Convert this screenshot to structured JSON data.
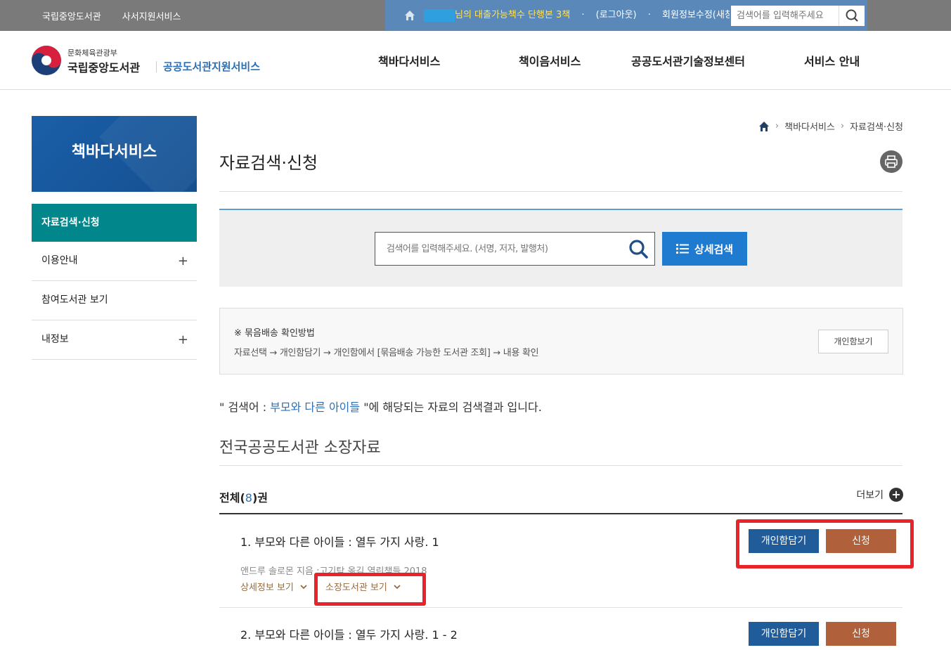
{
  "topbar": {
    "links": [
      "국립중앙도서관",
      "사서지원서비스"
    ],
    "loan_text": "님의 대출가능책수 단행본 3책",
    "logout": "(로그아웃)",
    "member_edit": "회원정보수정(새창)",
    "search_placeholder": "검색어를 입력해주세요"
  },
  "logo": {
    "ministry": "문화체육관광부",
    "library": "국립중앙도서관",
    "service": "공공도서관지원서비스"
  },
  "gnb": [
    "책바다서비스",
    "책이음서비스",
    "공공도서관기술정보센터",
    "서비스 안내"
  ],
  "sidebar": {
    "title": "책바다서비스",
    "items": [
      {
        "label": "자료검색·신청"
      },
      {
        "label": "이용안내",
        "expand": "+"
      },
      {
        "label": "참여도서관 보기"
      },
      {
        "label": "내정보",
        "expand": "+"
      }
    ]
  },
  "breadcrumb": [
    "책바다서비스",
    "자료검색·신청"
  ],
  "page_title": "자료검색·신청",
  "search": {
    "placeholder": "검색어를 입력해주세요. (서명, 저자, 발행처)",
    "detail_label": "상세검색"
  },
  "notice": {
    "heading": "※ 묶음배송 확인방법",
    "steps": "자료선택 → 개인함담기 → 개인함에서 [묶음배송 가능한 도서관 조회] → 내용 확인",
    "cart_view_label": "개인함보기"
  },
  "result": {
    "prefix": "\" 검색어 : ",
    "keyword": "부모와 다른 아이들",
    "suffix": " \"에 해당되는 자료의 검색결과 입니다."
  },
  "section_title": "전국공공도서관 소장자료",
  "total": {
    "prefix": "전체(",
    "count": "8",
    "suffix": ")권"
  },
  "more_label": "더보기",
  "books": [
    {
      "title": "1. 부모와 다른 아이들 : 열두 가지 사랑. 1",
      "meta": "앤드루 솔로몬 지음 ;고기탁 옮김   열린책들   2018",
      "detail_label": "상세정보 보기",
      "holdings_label": "소장도서관 보기",
      "cart_label": "개인함담기",
      "apply_label": "신청"
    },
    {
      "title": "2. 부모와 다른 아이들 : 열두 가지 사랑. 1 - 2",
      "cart_label": "개인함담기",
      "apply_label": "신청"
    }
  ],
  "colors": {
    "highlight": "#e8232a",
    "teal": "#00868b",
    "brand_blue": "#1e7bd0",
    "apply_brown": "#b0603a"
  }
}
